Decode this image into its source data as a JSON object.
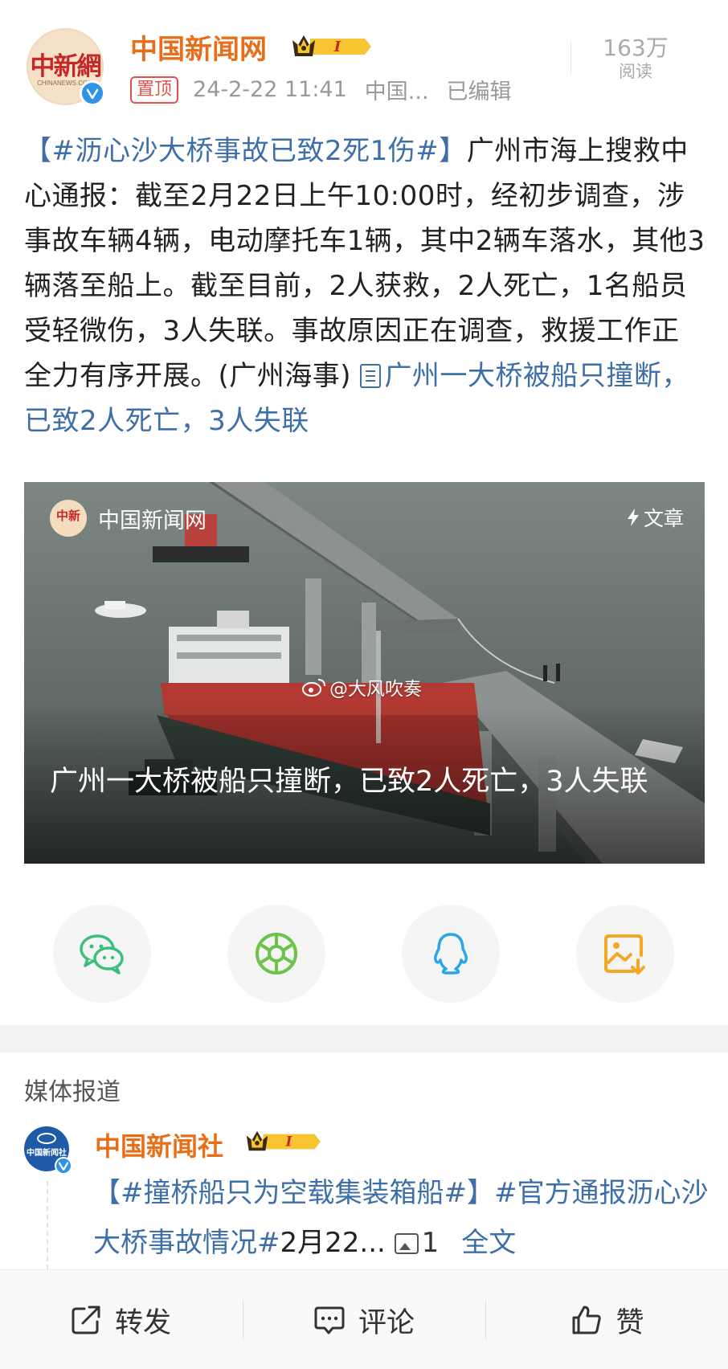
{
  "post": {
    "author": "中国新闻网",
    "avatar_text": "中新網",
    "avatar_subtext": "CHINANEWS.COM",
    "crown_level": "I",
    "pinned_label": "置顶",
    "timestamp": "24-2-22 11:41",
    "source": "中国...",
    "edited_label": "已编辑",
    "read_count": "163万",
    "read_label": "阅读",
    "hashtag": "【#沥心沙大桥事故已致2死1伤#】",
    "body": "广州市海上搜救中心通报：截至2月22日上午10:00时，经初步调查，涉事故车辆4辆，电动摩托车1辆，其中2辆车落水，其他3辆落至船上。截至目前，2人获救，2人死亡，1名船员受轻微伤，3人失联。事故原因正在调查，救援工作正全力有序开展。(广州海事) ",
    "link_text": "广州一大桥被船只撞断，已致2人死亡，3人失联"
  },
  "media_card": {
    "source_logo": "中新",
    "source_name": "中国新闻网",
    "badge": "文章",
    "watermark": "@大风吹奏",
    "caption": "广州一大桥被船只撞断，已致2人死亡，3人失联"
  },
  "share_targets": [
    "wechat-icon",
    "moments-icon",
    "qq-icon",
    "save-image-icon"
  ],
  "colors": {
    "username": "#e86f1a",
    "link": "#3e6fa8",
    "wechat": "#3bbf7a",
    "moments": "#6cc24a",
    "qq": "#2aa5e8",
    "save": "#f5a623"
  },
  "reports": {
    "section_title": "媒体报道",
    "item": {
      "author": "中国新闻社",
      "avatar_text": "中国新闻社",
      "crown_level": "I",
      "tag1": "【#撞桥船只为空载集装箱船#】",
      "tag2": "#官方通报沥心沙大桥事故情况#",
      "text_tail": "2月22...",
      "image_count": "1",
      "fulltext_label": "全文"
    }
  },
  "actions": {
    "repost": "转发",
    "comment": "评论",
    "like": "赞"
  }
}
